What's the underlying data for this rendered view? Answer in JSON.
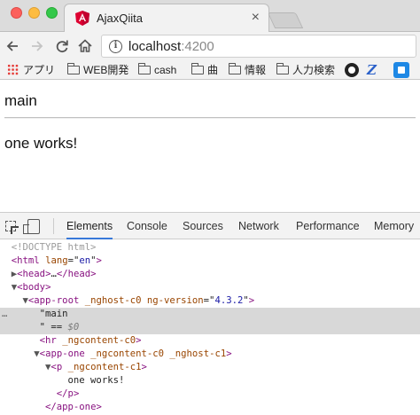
{
  "browser": {
    "tab_title": "AjaxQiita",
    "tab_close": "×",
    "url_host": "localhost",
    "url_port": ":4200",
    "icons": {
      "back": "back-arrow-icon",
      "forward": "forward-arrow-icon",
      "reload": "reload-icon",
      "home": "home-icon",
      "info": "info-icon"
    }
  },
  "bookmarks": {
    "apps": "アプリ",
    "items": [
      "WEB開発",
      "cash",
      "曲",
      "情報",
      "人力検索"
    ]
  },
  "page": {
    "main_text": "main",
    "paragraph": "one works!"
  },
  "devtools": {
    "tabs": [
      "Elements",
      "Console",
      "Sources",
      "Network",
      "Performance",
      "Memory"
    ],
    "active_tab": "Elements",
    "dom": {
      "doctype": "<!DOCTYPE html>",
      "html_tag": "html",
      "lang_attr": "lang",
      "lang_val": "en",
      "head_tag": "head",
      "body_tag": "body",
      "app_root_tag": "app-root",
      "app_root_attr1": "_nghost-c0",
      "app_root_attr2": "ng-version",
      "app_root_attr2_val": "4.3.2",
      "text_main": "\"main",
      "text_eq": "\" == ",
      "text_var": "$0",
      "hr_tag": "hr",
      "hr_attr": "_ngcontent-c0",
      "app_one_tag": "app-one",
      "app_one_attr1": "_ngcontent-c0",
      "app_one_attr2": "_nghost-c1",
      "p_tag": "p",
      "p_attr": "_ngcontent-c1",
      "p_text": "one works!"
    }
  }
}
